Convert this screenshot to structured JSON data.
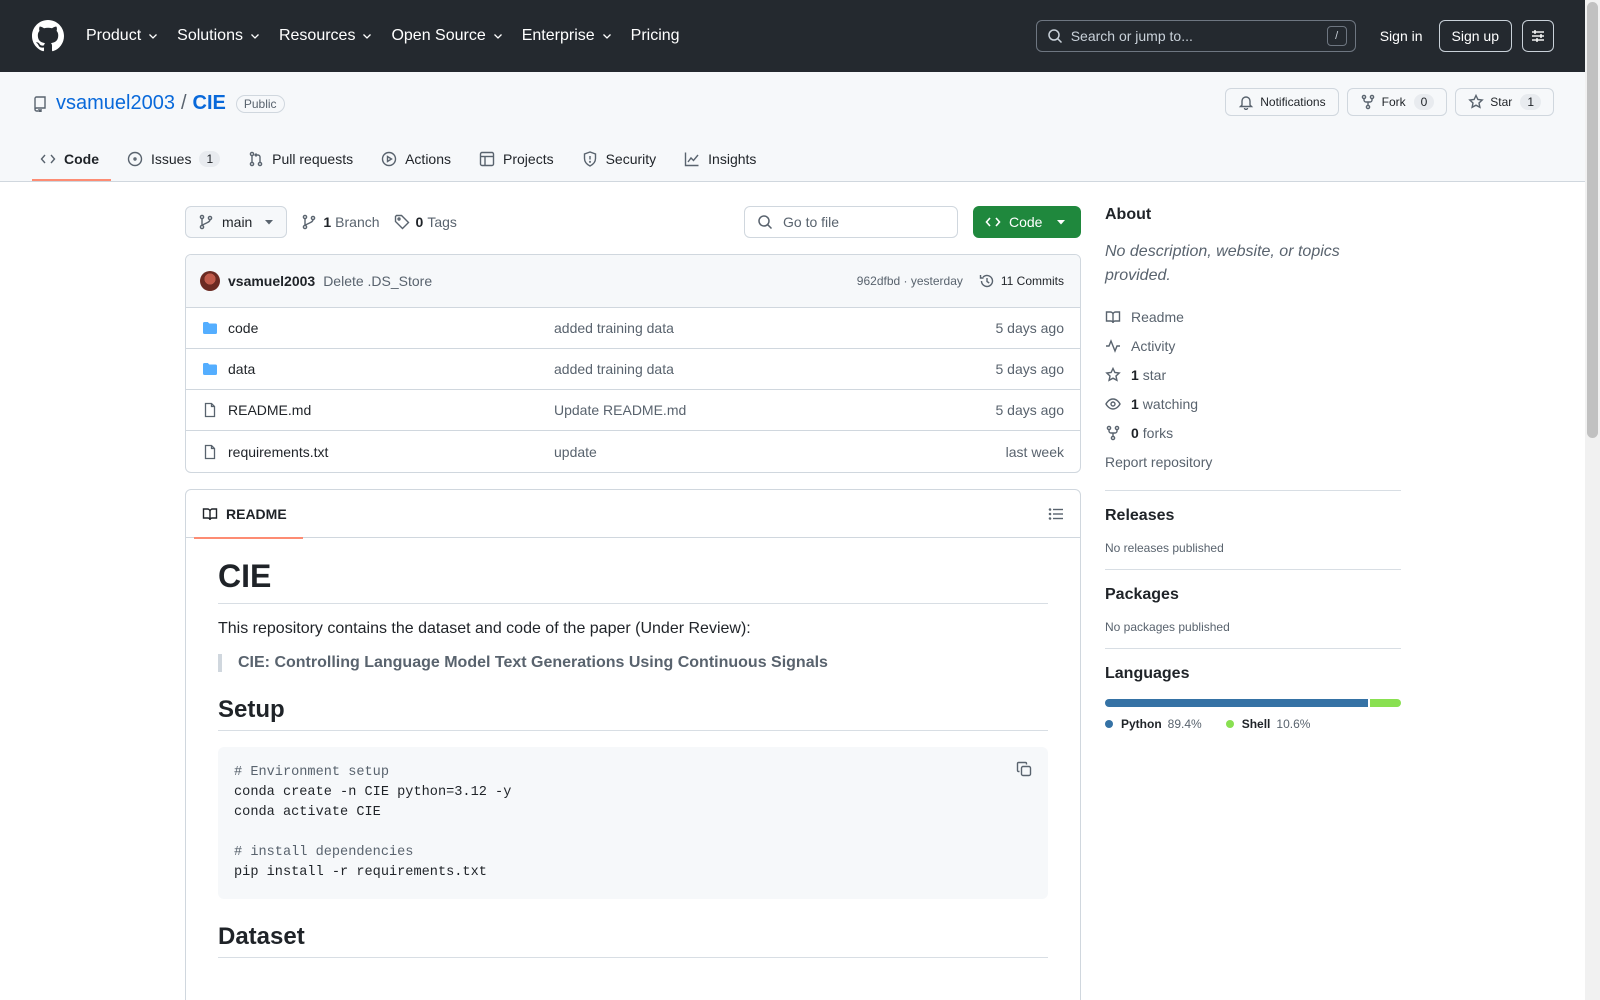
{
  "header": {
    "nav": [
      {
        "label": "Product",
        "dropdown": true
      },
      {
        "label": "Solutions",
        "dropdown": true
      },
      {
        "label": "Resources",
        "dropdown": true
      },
      {
        "label": "Open Source",
        "dropdown": true
      },
      {
        "label": "Enterprise",
        "dropdown": true
      },
      {
        "label": "Pricing",
        "dropdown": false
      }
    ],
    "search_placeholder": "Search or jump to...",
    "search_shortcut": "/",
    "signin": "Sign in",
    "signup": "Sign up"
  },
  "repo": {
    "owner": "vsamuel2003",
    "separator": "/",
    "name": "CIE",
    "visibility": "Public",
    "notifications": "Notifications",
    "fork_label": "Fork",
    "fork_count": "0",
    "star_label": "Star",
    "star_count": "1"
  },
  "tabs": [
    {
      "label": "Code",
      "icon": "code-icon",
      "active": true,
      "count": ""
    },
    {
      "label": "Issues",
      "icon": "issue-icon",
      "active": false,
      "count": "1"
    },
    {
      "label": "Pull requests",
      "icon": "pull-request-icon",
      "active": false,
      "count": ""
    },
    {
      "label": "Actions",
      "icon": "play-icon",
      "active": false,
      "count": ""
    },
    {
      "label": "Projects",
      "icon": "table-icon",
      "active": false,
      "count": ""
    },
    {
      "label": "Security",
      "icon": "shield-icon",
      "active": false,
      "count": ""
    },
    {
      "label": "Insights",
      "icon": "graph-icon",
      "active": false,
      "count": ""
    }
  ],
  "filebar": {
    "branch": "main",
    "branch_count": "1",
    "branch_label": "Branch",
    "tag_count": "0",
    "tag_label": "Tags",
    "goto_placeholder": "Go to file",
    "code_button": "Code"
  },
  "commit": {
    "author": "vsamuel2003",
    "message": "Delete .DS_Store",
    "sha_time": "962dfbd · yesterday",
    "commits": "11 Commits"
  },
  "files": [
    {
      "name": "code",
      "type": "folder",
      "message": "added training data",
      "date": "5 days ago"
    },
    {
      "name": "data",
      "type": "folder",
      "message": "added training data",
      "date": "5 days ago"
    },
    {
      "name": "README.md",
      "type": "file",
      "message": "Update README.md",
      "date": "5 days ago"
    },
    {
      "name": "requirements.txt",
      "type": "file",
      "message": "update",
      "date": "last week"
    }
  ],
  "readme": {
    "tab": "README",
    "h1": "CIE",
    "intro": "This repository contains the dataset and code of the paper (Under Review):",
    "quote": "CIE: Controlling Language Model Text Generations Using Continuous Signals",
    "h2_setup": "Setup",
    "code_lines": [
      {
        "text": "# Environment setup",
        "comment": true
      },
      {
        "text": "conda create -n CIE python=3.12 -y",
        "comment": false
      },
      {
        "text": "conda activate CIE",
        "comment": false
      },
      {
        "text": "",
        "comment": false
      },
      {
        "text": "# install dependencies",
        "comment": true
      },
      {
        "text": "pip install -r requirements.txt",
        "comment": false
      }
    ],
    "h2_dataset": "Dataset"
  },
  "sidebar": {
    "about_title": "About",
    "about_desc": "No description, website, or topics provided.",
    "readme": "Readme",
    "activity": "Activity",
    "stars_count": "1",
    "stars_label": "star",
    "watching_count": "1",
    "watching_label": "watching",
    "forks_count": "0",
    "forks_label": "forks",
    "report": "Report repository",
    "releases_title": "Releases",
    "releases_text": "No releases published",
    "packages_title": "Packages",
    "packages_text": "No packages published",
    "languages_title": "Languages",
    "languages": [
      {
        "name": "Python",
        "percent": "89.4%",
        "fraction": 0.894,
        "color": "#3572A5"
      },
      {
        "name": "Shell",
        "percent": "10.6%",
        "fraction": 0.106,
        "color": "#89e051"
      }
    ]
  }
}
